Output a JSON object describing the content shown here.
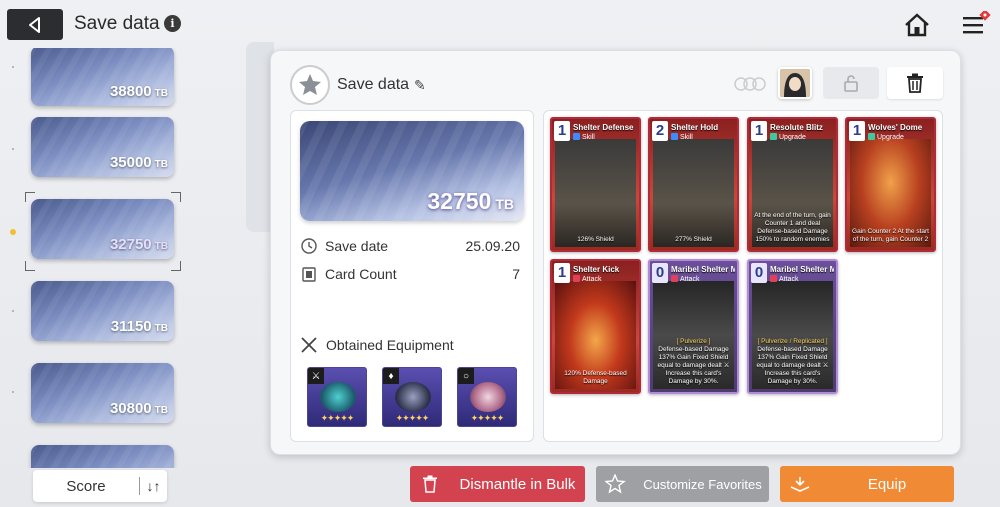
{
  "header": {
    "title": "Save data",
    "info": "i"
  },
  "icons": {
    "back": "back-arrow-icon",
    "home": "home-icon",
    "menu": "menu-icon"
  },
  "colors": {
    "dismantle": "#d2434f",
    "customize": "#9ea0a4",
    "equip": "#f08a34",
    "accent": "#e23a3a"
  },
  "save_list": [
    {
      "value": "38800",
      "unit": "TB"
    },
    {
      "value": "35000",
      "unit": "TB"
    },
    {
      "value": "32750",
      "unit": "TB",
      "selected": true
    },
    {
      "value": "31150",
      "unit": "TB"
    },
    {
      "value": "30800",
      "unit": "TB"
    }
  ],
  "sort": {
    "label": "Score",
    "toggle": "↓↑"
  },
  "panel": {
    "title": "Save data",
    "score_value": "32750",
    "score_unit": "TB",
    "save_date_label": "Save date",
    "save_date_value": "25.09.20",
    "card_count_label": "Card Count",
    "card_count_value": "7",
    "equipment_label": "Obtained Equipment"
  },
  "equipment": [
    {
      "type": "weapon",
      "stars": "✦✦✦✦✦"
    },
    {
      "type": "armor",
      "stars": "✦✦✦✦✦"
    },
    {
      "type": "ring",
      "stars": "✦✦✦✦✦"
    }
  ],
  "cards": [
    {
      "cost": "1",
      "name": "Shelter Defense",
      "type": "Skill",
      "desc": "126% Shield"
    },
    {
      "cost": "2",
      "name": "Shelter Hold",
      "type": "Skill",
      "desc": "277% Shield"
    },
    {
      "cost": "1",
      "name": "Resolute Blitz",
      "type": "Upgrade",
      "desc": "At the end of the turn, gain Counter 1 and deal Defense-based Damage 150% to random enemies"
    },
    {
      "cost": "1",
      "name": "Wolves' Dome",
      "type": "Upgrade",
      "desc": "Gain Counter 2 At the start of the turn, gain Counter 2"
    },
    {
      "cost": "1",
      "name": "Shelter Kick",
      "type": "Attack",
      "desc": "120% Defense-based Damage"
    },
    {
      "cost": "0",
      "name": "Maribel Shelter MK.II",
      "type": "Attack",
      "tag": "[ Pulverize ]",
      "desc": "Defense-based Damage 137% Gain Fixed Shield equal to damage dealt ⚔ Increase this card's Damage by 30%."
    },
    {
      "cost": "0",
      "name": "Maribel Shelter MK.II",
      "type": "Attack",
      "tag": "[ Pulverize / Replicated ]",
      "desc": "Defense-based Damage 137% Gain Fixed Shield equal to damage dealt ⚔ Increase this card's Damage by 30%."
    }
  ],
  "buttons": {
    "dismantle": "Dismantle in Bulk",
    "customize": "Customize Favorites",
    "equip": "Equip"
  }
}
